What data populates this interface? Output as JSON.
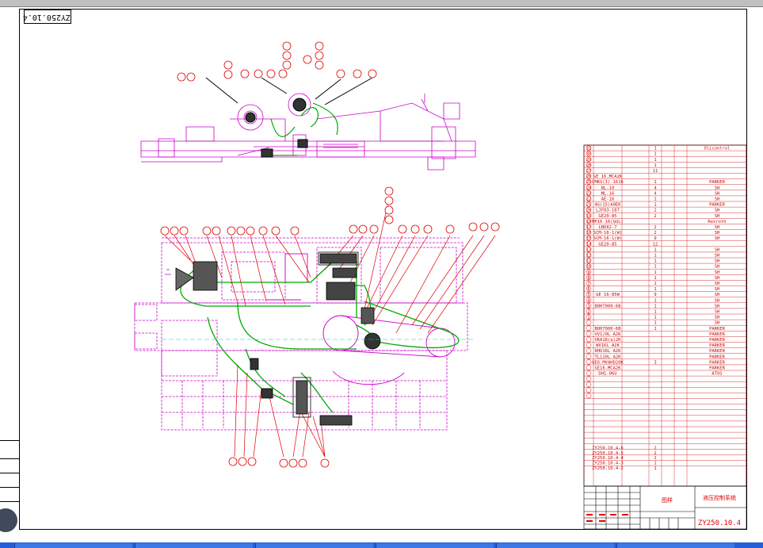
{
  "drawing_number": "ZY250.10.4",
  "title_block": {
    "drawing_number": "ZY250.10.4",
    "title_label": "图样",
    "name_label": "液压控制系统"
  },
  "bom": {
    "rows": [
      {
        "no": "31",
        "code": "",
        "name": "",
        "qty": "1",
        "maker": "Olicontrol"
      },
      {
        "no": "30",
        "code": "",
        "name": "",
        "qty": "1",
        "maker": ""
      },
      {
        "no": "29",
        "code": "",
        "name": "",
        "qty": "1",
        "maker": ""
      },
      {
        "no": "28",
        "code": "",
        "name": "",
        "qty": "1",
        "maker": ""
      },
      {
        "no": "27",
        "code": "",
        "name": "",
        "qty": "11",
        "maker": ""
      },
      {
        "no": "26",
        "code": "GE 16.MCA2K",
        "name": "",
        "qty": "",
        "maker": ""
      },
      {
        "no": "25",
        "code": "CMKS(I)-1616",
        "name": "",
        "qty": "1",
        "maker": "PARKER"
      },
      {
        "no": "24",
        "code": "BL-10",
        "name": "",
        "qty": "4",
        "maker": "SH"
      },
      {
        "no": "23",
        "code": "ML-16",
        "name": "",
        "qty": "4",
        "maker": "SH"
      },
      {
        "no": "22",
        "code": "AE-16",
        "name": "",
        "qty": "1",
        "maker": "SH"
      },
      {
        "no": "21",
        "code": "4G(15)A0EK",
        "name": "",
        "qty": "1",
        "maker": "PARKER"
      },
      {
        "no": "20",
        "code": "LJF83-187",
        "name": "",
        "qty": "2",
        "maker": "SH"
      },
      {
        "no": "19",
        "code": "GE20-85",
        "name": "",
        "qty": "2",
        "maker": "SH"
      },
      {
        "no": "18",
        "code": "MP16-16(GUL)",
        "name": "",
        "qty": "",
        "maker": "Rexroth"
      },
      {
        "no": "17",
        "code": "LBD82-7",
        "name": "",
        "qty": "2",
        "maker": "SH"
      },
      {
        "no": "16",
        "code": "SCM-16-1(W)",
        "name": "",
        "qty": "2",
        "maker": "SH"
      },
      {
        "no": "15",
        "code": "SCM-16-1(W)",
        "name": "",
        "qty": "9",
        "maker": "SH"
      },
      {
        "no": "14",
        "code": "GE20-85",
        "name": "",
        "qty": "12",
        "maker": ""
      },
      {
        "no": "13",
        "code": "",
        "name": "",
        "qty": "1",
        "maker": "SH"
      },
      {
        "no": "12",
        "code": "",
        "name": "",
        "qty": "1",
        "maker": "SH"
      },
      {
        "no": "11",
        "code": "",
        "name": "",
        "qty": "1",
        "maker": "SH"
      },
      {
        "no": "10",
        "code": "",
        "name": "",
        "qty": "1",
        "maker": "SH"
      },
      {
        "no": "9",
        "code": "",
        "name": "",
        "qty": "1",
        "maker": "SH"
      },
      {
        "no": "8",
        "code": "",
        "name": "",
        "qty": "1",
        "maker": "SH"
      },
      {
        "no": "7",
        "code": "",
        "name": "",
        "qty": "1",
        "maker": "SH"
      },
      {
        "no": "6",
        "code": "",
        "name": "",
        "qty": "1",
        "maker": "SH"
      },
      {
        "no": "5",
        "code": "GE 16-85W",
        "name": "",
        "qty": "9",
        "maker": "SH"
      },
      {
        "no": "4",
        "code": "",
        "name": "",
        "qty": "1",
        "maker": "SH"
      },
      {
        "no": "3",
        "code": "B0H7000-6B",
        "name": "",
        "qty": "1",
        "maker": "SH"
      },
      {
        "no": "2",
        "code": "",
        "name": "",
        "qty": "1",
        "maker": "SH"
      },
      {
        "no": "1",
        "code": "",
        "name": "",
        "qty": "1",
        "maker": "SH"
      }
    ],
    "rows_b": [
      {
        "code": "",
        "qty": "1",
        "maker": "SH"
      },
      {
        "code": "B0H7000-6B",
        "qty": "1",
        "maker": "PARKER"
      },
      {
        "code": "VV1/0L A2K",
        "qty": "",
        "maker": "PARKER"
      },
      {
        "code": "VKA18(a)2K",
        "qty": "",
        "maker": "PARKER"
      },
      {
        "code": "WV16L A2K",
        "qty": "",
        "maker": "PARKER"
      },
      {
        "code": "RHU16L A2K",
        "qty": "",
        "maker": "PARKER"
      },
      {
        "code": "TL110L A2K",
        "qty": "",
        "maker": "PARKER"
      },
      {
        "code": "GE6.MVAHD20K",
        "qty": "3",
        "maker": "PARKER"
      },
      {
        "code": "GE16.MCA2K",
        "qty": "",
        "maker": "PARKER"
      },
      {
        "code": "DH1-06U",
        "qty": "",
        "maker": "ATOS"
      }
    ],
    "lower_rows": [
      {
        "code": "ZY250.10.4-6",
        "qty": "2"
      },
      {
        "code": "ZY250.10.4-5",
        "qty": "2"
      },
      {
        "code": "ZY250.10.4-4",
        "qty": "1"
      },
      {
        "code": "ZY250.10.4-3",
        "qty": "1"
      },
      {
        "code": "ZY250.10.4-2",
        "qty": "1"
      }
    ]
  },
  "colors": {
    "frame": "#000000",
    "machine_outline": "#cc00cc",
    "hose": "#00aa00",
    "callout": "#e00000",
    "taskbar": "#245edb"
  }
}
